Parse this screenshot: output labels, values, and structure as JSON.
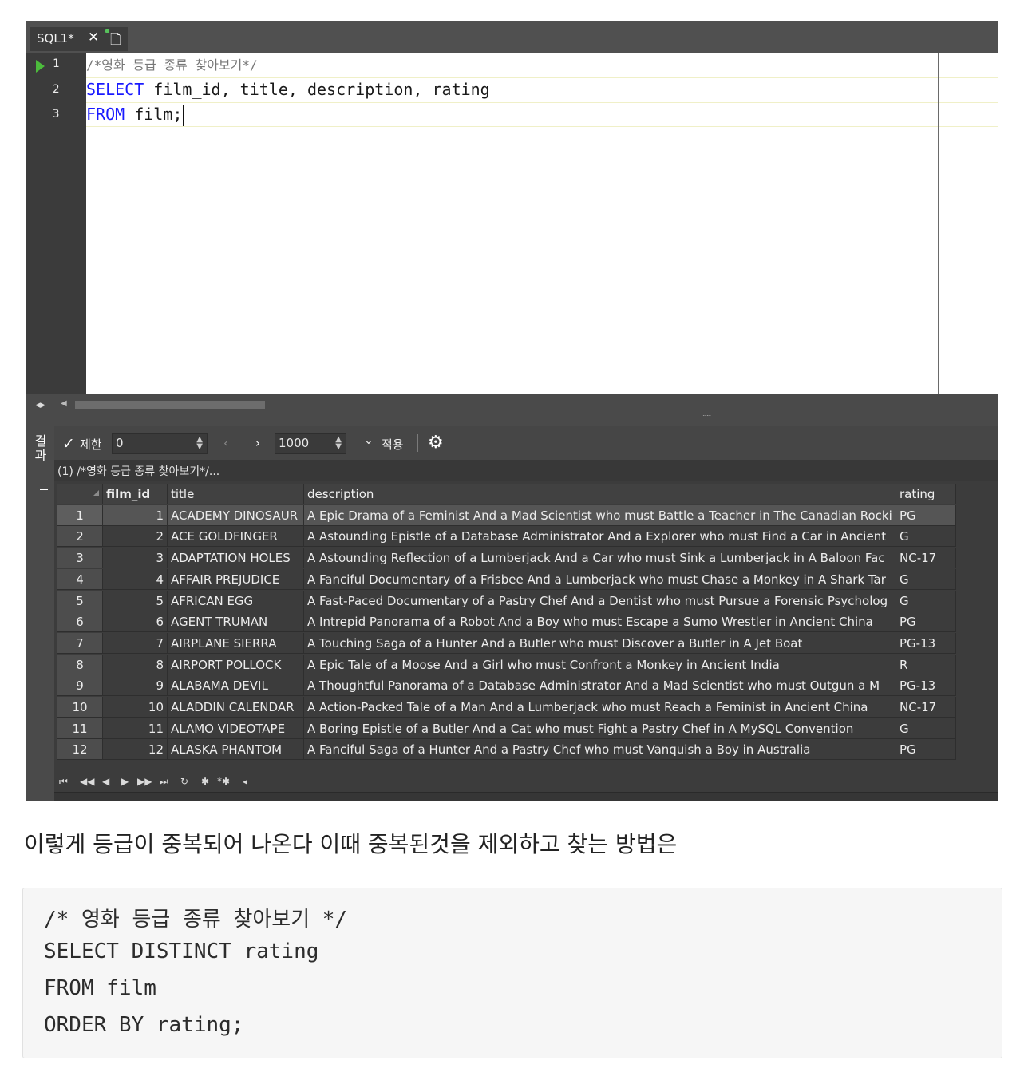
{
  "editor": {
    "tab_label": "SQL1*",
    "close_glyph": "✕",
    "new_tab_glyph": "🗋",
    "line_numbers": [
      "1",
      "2",
      "3"
    ],
    "line1": "/*영화 등급 종류 찾아보기*/",
    "line2_kw": "SELECT",
    "line2_rest": " film_id, title, description, rating",
    "line3_kw": "FROM",
    "line3_rest": " film;"
  },
  "results": {
    "side_label_1": "결",
    "side_label_2": "과",
    "limit_check": "✓",
    "limit_label": "제한",
    "limit_value": "0",
    "prev_glyph": "‹",
    "next_glyph": "›",
    "page_size": "1000",
    "apply_glyph": "⌄",
    "apply_label": "적용",
    "settings_glyph": "⚙",
    "result_title": "(1) /*영화 등급 종류 찾아보기*/...",
    "columns": [
      "film_id",
      "title",
      "description",
      "rating"
    ],
    "rows": [
      {
        "n": "1",
        "film_id": "1",
        "title": "ACADEMY DINOSAUR",
        "description": "A Epic Drama of a Feminist And a Mad Scientist who must Battle a Teacher in The Canadian Rocki",
        "rating": "PG"
      },
      {
        "n": "2",
        "film_id": "2",
        "title": "ACE GOLDFINGER",
        "description": "A Astounding Epistle of a Database Administrator And a Explorer who must Find a Car in Ancient",
        "rating": "G"
      },
      {
        "n": "3",
        "film_id": "3",
        "title": "ADAPTATION HOLES",
        "description": "A Astounding Reflection of a Lumberjack And a Car who must Sink a Lumberjack in A Baloon Fac",
        "rating": "NC-17"
      },
      {
        "n": "4",
        "film_id": "4",
        "title": "AFFAIR PREJUDICE",
        "description": "A Fanciful Documentary of a Frisbee And a Lumberjack who must Chase a Monkey in A Shark Tar",
        "rating": "G"
      },
      {
        "n": "5",
        "film_id": "5",
        "title": "AFRICAN EGG",
        "description": "A Fast-Paced Documentary of a Pastry Chef And a Dentist who must Pursue a Forensic Psycholog",
        "rating": "G"
      },
      {
        "n": "6",
        "film_id": "6",
        "title": "AGENT TRUMAN",
        "description": "A Intrepid Panorama of a Robot And a Boy who must Escape a Sumo Wrestler in Ancient China",
        "rating": "PG"
      },
      {
        "n": "7",
        "film_id": "7",
        "title": "AIRPLANE SIERRA",
        "description": "A Touching Saga of a Hunter And a Butler who must Discover a Butler in A Jet Boat",
        "rating": "PG-13"
      },
      {
        "n": "8",
        "film_id": "8",
        "title": "AIRPORT POLLOCK",
        "description": "A Epic Tale of a Moose And a Girl who must Confront a Monkey in Ancient India",
        "rating": "R"
      },
      {
        "n": "9",
        "film_id": "9",
        "title": "ALABAMA DEVIL",
        "description": "A Thoughtful Panorama of a Database Administrator And a Mad Scientist who must Outgun a M",
        "rating": "PG-13"
      },
      {
        "n": "10",
        "film_id": "10",
        "title": "ALADDIN CALENDAR",
        "description": "A Action-Packed Tale of a Man And a Lumberjack who must Reach a Feminist in Ancient China",
        "rating": "NC-17"
      },
      {
        "n": "11",
        "film_id": "11",
        "title": "ALAMO VIDEOTAPE",
        "description": "A Boring Epistle of a Butler And a Cat who must Fight a Pastry Chef in A MySQL Convention",
        "rating": "G"
      },
      {
        "n": "12",
        "film_id": "12",
        "title": "ALASKA PHANTOM",
        "description": "A Fanciful Saga of a Hunter And a Pastry Chef who must Vanquish a Boy in Australia",
        "rating": "PG"
      }
    ],
    "pager_icons": [
      "⏮",
      "◀◀",
      "◀",
      "▶",
      "▶▶",
      "⏭",
      "↻",
      "✱",
      "*✱",
      "◂"
    ]
  },
  "caption": "이렇게 등급이 중복되어 나온다 이때 중복된것을 제외하고 찾는 방법은",
  "code_block": {
    "line1": "/* 영화 등급 종류 찾아보기 */",
    "line2": "SELECT DISTINCT rating",
    "line3": "FROM film",
    "line4": "ORDER BY rating;"
  }
}
